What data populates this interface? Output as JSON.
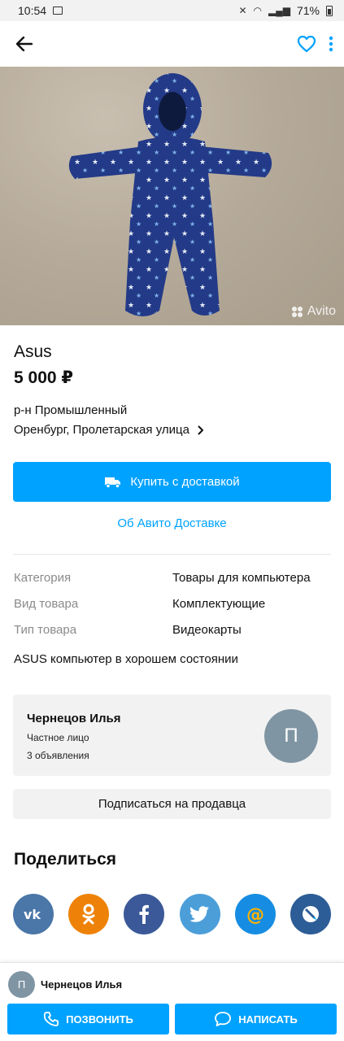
{
  "status_bar": {
    "time": "10:54",
    "battery": "71%"
  },
  "app_bar": {
    "back_icon": "arrow-left-icon",
    "favorite_icon": "heart-outline-icon",
    "more_icon": "more-vertical-icon",
    "accent_color": "#00a2ff"
  },
  "listing": {
    "photo_watermark": "Avito",
    "title": "Asus",
    "price": "5 000 ₽",
    "district": "р-н Промышленный",
    "address": "Оренбург, Пролетарская улица",
    "buy_button_label": "Купить с доставкой",
    "delivery_link": "Об Авито Доставке",
    "params": [
      {
        "key": "Категория",
        "value": "Товары для компьютера"
      },
      {
        "key": "Вид товара",
        "value": "Комплектующие"
      },
      {
        "key": "Тип товара",
        "value": "Видеокарты"
      }
    ],
    "description": "ASUS компьютер в хорошем состоянии"
  },
  "seller": {
    "name": "Чернецов Илья",
    "type": "Частное лицо",
    "ads_count": "3 объявления",
    "avatar_letter": "П",
    "avatar_color": "#7f95a3",
    "subscribe_label": "Подписаться на продавца"
  },
  "share": {
    "title": "Поделиться",
    "networks": [
      {
        "name": "vk-icon",
        "label": "vk",
        "color": "#4a76a8"
      },
      {
        "name": "odnoklassniki-icon",
        "label": "ok",
        "color": "#ee8208"
      },
      {
        "name": "facebook-icon",
        "label": "f",
        "color": "#3b5998"
      },
      {
        "name": "twitter-icon",
        "label": "tw",
        "color": "#4c9ed9"
      },
      {
        "name": "mail-icon",
        "label": "@",
        "color": "#168de2"
      },
      {
        "name": "livejournal-icon",
        "label": "lj",
        "color": "#2d5d96"
      }
    ]
  },
  "bottom_bar": {
    "avatar_letter": "П",
    "name": "Чернецов Илья",
    "call_label": "ПОЗВОНИТЬ",
    "message_label": "НАПИСАТЬ"
  }
}
